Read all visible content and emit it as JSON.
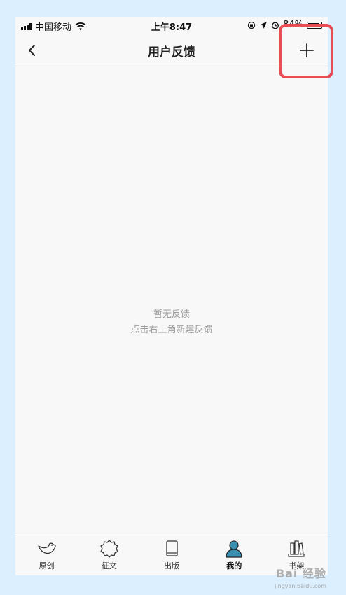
{
  "status_bar": {
    "carrier": "中国移动",
    "time": "上午8:47",
    "battery_percent": "84%"
  },
  "navbar": {
    "title": "用户反馈",
    "back_icon": "chevron-left-icon",
    "add_icon": "plus-icon"
  },
  "empty_state": {
    "line1": "暂无反馈",
    "line2": "点击右上角新建反馈"
  },
  "tabs": [
    {
      "label": "原创",
      "icon": "bird-icon"
    },
    {
      "label": "征文",
      "icon": "badge-icon"
    },
    {
      "label": "出版",
      "icon": "book-icon"
    },
    {
      "label": "我的",
      "icon": "person-icon",
      "active": true
    },
    {
      "label": "书架",
      "icon": "bookshelf-icon"
    }
  ],
  "watermark": {
    "text": "Bai 经验",
    "url": "jingyan.baidu.com"
  },
  "colors": {
    "highlight": "#e84c55",
    "active_tab_icon": "#3a8fb0"
  }
}
